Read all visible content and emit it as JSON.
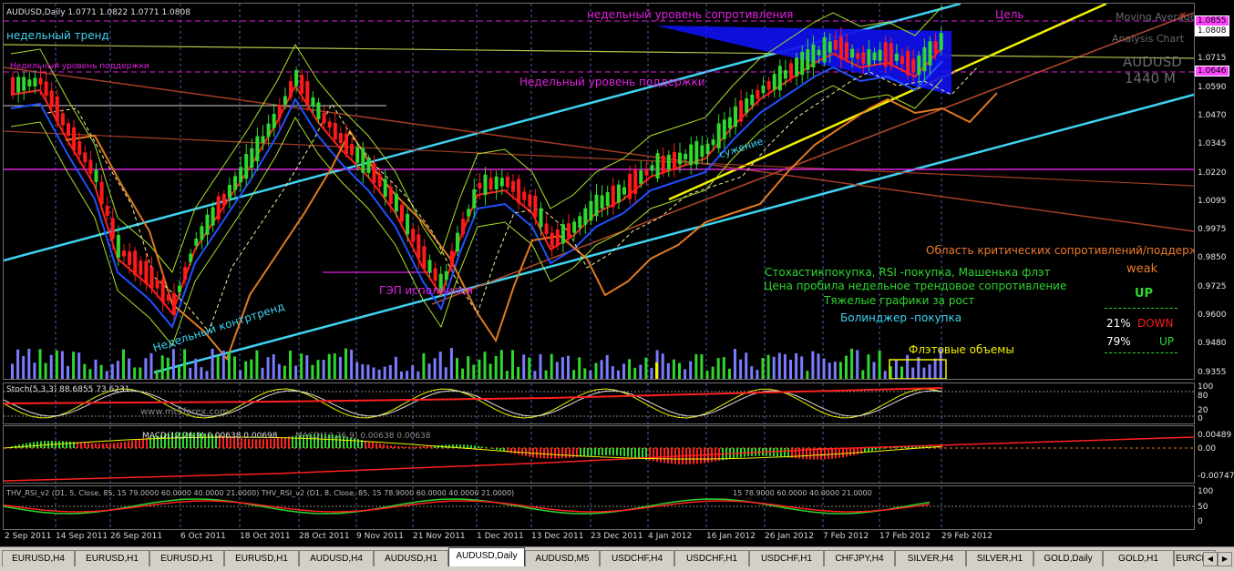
{
  "window": {
    "symbol_header": "AUDUSD,Daily  1.0771 1.0822 1.0771 1.0808",
    "chart_brand_1": "Moving Average",
    "chart_brand_2": "Analysis Chart",
    "chart_symbol": "AUDUSD",
    "chart_timeframe": "1440 M"
  },
  "annotations": {
    "weekly_resistance": "недельный уровень сопротивления",
    "target": "Цель",
    "weekly_trend": "недельный тренд",
    "weekly_support_small": "Недельный уровень поддержки",
    "weekly_support": "Недельный уровень поддержки",
    "weekly_countertrend": "Недельный контртренд",
    "gap": "ГЭП исполнился",
    "critical_zone": "Область критических сопротивлений/поддержек",
    "signals_1": "Стохастикпокупка, RSI -покупка, Машенька флэт",
    "signals_2": "Цена пробила недельное трендовое сопротивление",
    "signals_3": "Тяжелые графики за рост",
    "signals_4": "Болинджер -покупка",
    "flat_volumes": "Флэтовые объемы",
    "narrowing": "сужение",
    "watermark": "www.mt5forex.com"
  },
  "strength_panel": {
    "weak": "weak",
    "up": "UP",
    "down_pct": "21%",
    "down_label": "DOWN",
    "up_pct": "79%",
    "up_label": "UP"
  },
  "price_axis": {
    "labels": [
      "1.0850",
      "1.0715",
      "1.0590",
      "1.0470",
      "1.0345",
      "1.0220",
      "1.0095",
      "0.9975",
      "0.9850",
      "0.9725",
      "0.9600",
      "0.9480",
      "0.9355"
    ],
    "resistance_box": "1.0855",
    "current_box": "1.0808",
    "support_box": "1.0646"
  },
  "indicators": {
    "stoch_header": "Stoch(5,3,3) 88.6855 73.6231",
    "stoch_axis": [
      "100",
      "80",
      "20",
      "0"
    ],
    "macd_header": "MACD(12,26,9) 0.00638 0.00698",
    "macd_header_2": "MACD(12,26,9) 0.00638 0.00638",
    "macd_axis": [
      "0.00489",
      "0.00",
      "-0.00747"
    ],
    "rsi_header": "THV_RSI_v2 (D1, 5, Close, 85, 15 79.0000 60.0000 40.0000 21.0000)   THV_RSI_v2 (D1, 8, Close, 85, 15 78.9000 60.0000 40.0000 21.0000)",
    "rsi_header_2": "15 78.9000 60.0000 40.0000 21.0000",
    "rsi_axis": [
      "100",
      "50",
      "0"
    ]
  },
  "dates": [
    "2 Sep 2011",
    "14 Sep 2011",
    "26 Sep 2011",
    "6 Oct 2011",
    "18 Oct 2011",
    "28 Oct 2011",
    "9 Nov 2011",
    "21 Nov 2011",
    "1 Dec 2011",
    "13 Dec 2011",
    "23 Dec 2011",
    "4 Jan 2012",
    "16 Jan 2012",
    "26 Jan 2012",
    "7 Feb 2012",
    "17 Feb 2012",
    "29 Feb 2012"
  ],
  "tabs": [
    "EURUSD,H4",
    "EURUSD,H1",
    "EURUSD,H1",
    "EURUSD,H1",
    "AUDUSD,H4",
    "AUDUSD,H1",
    "AUDUSD,Daily",
    "AUDUSD,M5",
    "USDCHF,H4",
    "USDCHF,H1",
    "USDCHF,H1",
    "CHFJPY,H4",
    "SILVER,H4",
    "SILVER,H1",
    "GOLD,Daily",
    "GOLD,H1",
    "EURCHF"
  ],
  "active_tab": "AUDUSD,Daily",
  "colors": {
    "bull": "#2fd72f",
    "bear": "#ff1a1a",
    "cyan": "#3fd3f2",
    "yellow": "#f2f200",
    "magenta": "#e020e0",
    "grid": "#4a5fa8"
  },
  "chart_data": {
    "type": "candlestick",
    "instrument": "AUDUSD",
    "timeframe": "Daily",
    "ylim": [
      0.9355,
      1.0855
    ],
    "last": {
      "open": 1.0771,
      "high": 1.0822,
      "low": 1.0771,
      "close": 1.0808
    },
    "levels": {
      "weekly_resistance": 1.0855,
      "weekly_support": 1.0646
    }
  }
}
